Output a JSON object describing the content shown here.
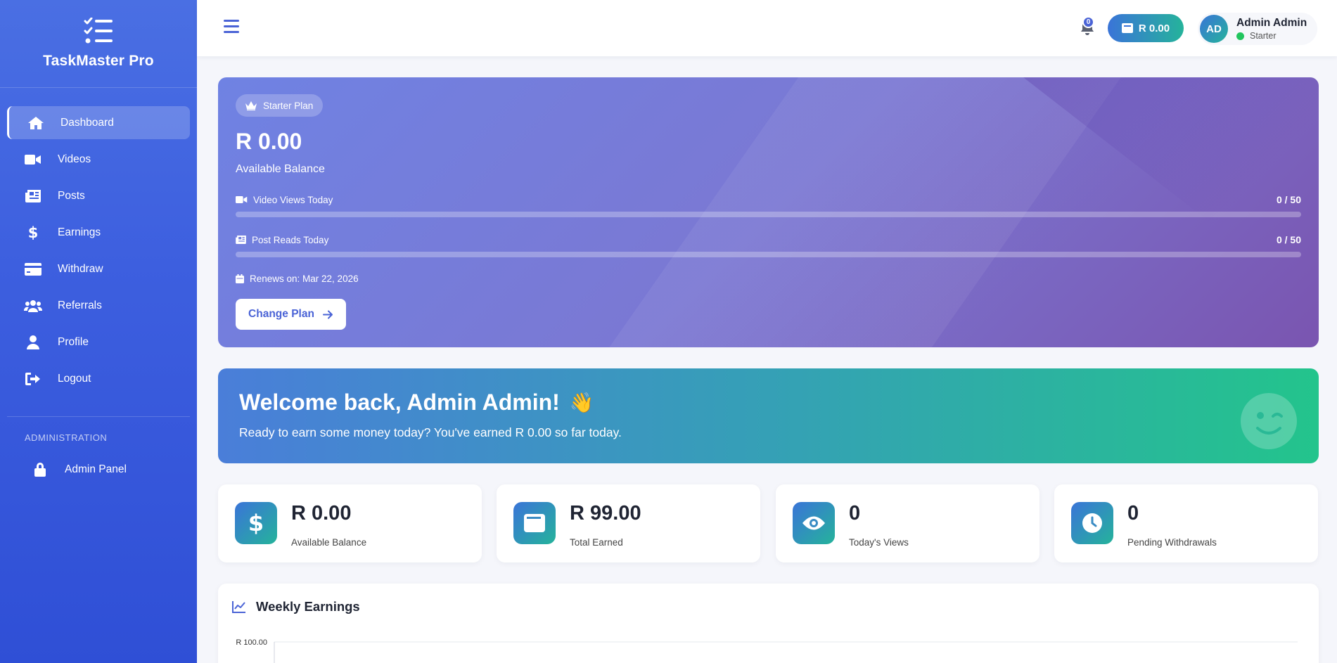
{
  "app": {
    "title": "TaskMaster Pro"
  },
  "sidebar": {
    "items": [
      {
        "label": "Dashboard",
        "icon": "home-icon",
        "active": true
      },
      {
        "label": "Videos",
        "icon": "video-icon"
      },
      {
        "label": "Posts",
        "icon": "newspaper-icon"
      },
      {
        "label": "Earnings",
        "icon": "dollar-icon"
      },
      {
        "label": "Withdraw",
        "icon": "credit-card-icon"
      },
      {
        "label": "Referrals",
        "icon": "users-icon"
      },
      {
        "label": "Profile",
        "icon": "user-icon"
      },
      {
        "label": "Logout",
        "icon": "logout-icon"
      }
    ],
    "admin_section": "ADMINISTRATION",
    "admin_item": {
      "label": "Admin Panel",
      "icon": "lock-icon"
    }
  },
  "topbar": {
    "notifications_count": "0",
    "wallet_balance": "R 0.00",
    "user": {
      "initials": "AD",
      "name": "Admin Admin",
      "plan": "Starter",
      "status_color": "#22c55e"
    }
  },
  "plan_card": {
    "badge": "Starter Plan",
    "amount": "R 0.00",
    "subtitle": "Available Balance",
    "progress": [
      {
        "label": "Video Views Today",
        "value_text": "0 / 50",
        "fraction": 0
      },
      {
        "label": "Post Reads Today",
        "value_text": "0 / 50",
        "fraction": 0
      }
    ],
    "renews": "Renews on: Mar 22, 2026",
    "button": "Change Plan"
  },
  "welcome": {
    "title": "Welcome back, Admin Admin!",
    "emoji": "👋",
    "message": "Ready to earn some money today? You've earned R 0.00 so far today."
  },
  "stats": [
    {
      "value": "R 0.00",
      "label": "Available Balance",
      "icon": "dollar-icon"
    },
    {
      "value": "R 99.00",
      "label": "Total Earned",
      "icon": "wallet-icon"
    },
    {
      "value": "0",
      "label": "Today's Views",
      "icon": "eye-icon"
    },
    {
      "value": "0",
      "label": "Pending Withdrawals",
      "icon": "clock-icon"
    }
  ],
  "colors": {
    "primary": "#4a63d6",
    "accent_teal": "#25b39b",
    "sidebar": "#3d5fdf"
  },
  "chart_data": {
    "type": "line",
    "title": "Weekly Earnings",
    "y_tick_labels": [
      "R 100.00"
    ],
    "ylim": [
      0,
      100
    ],
    "series": []
  }
}
